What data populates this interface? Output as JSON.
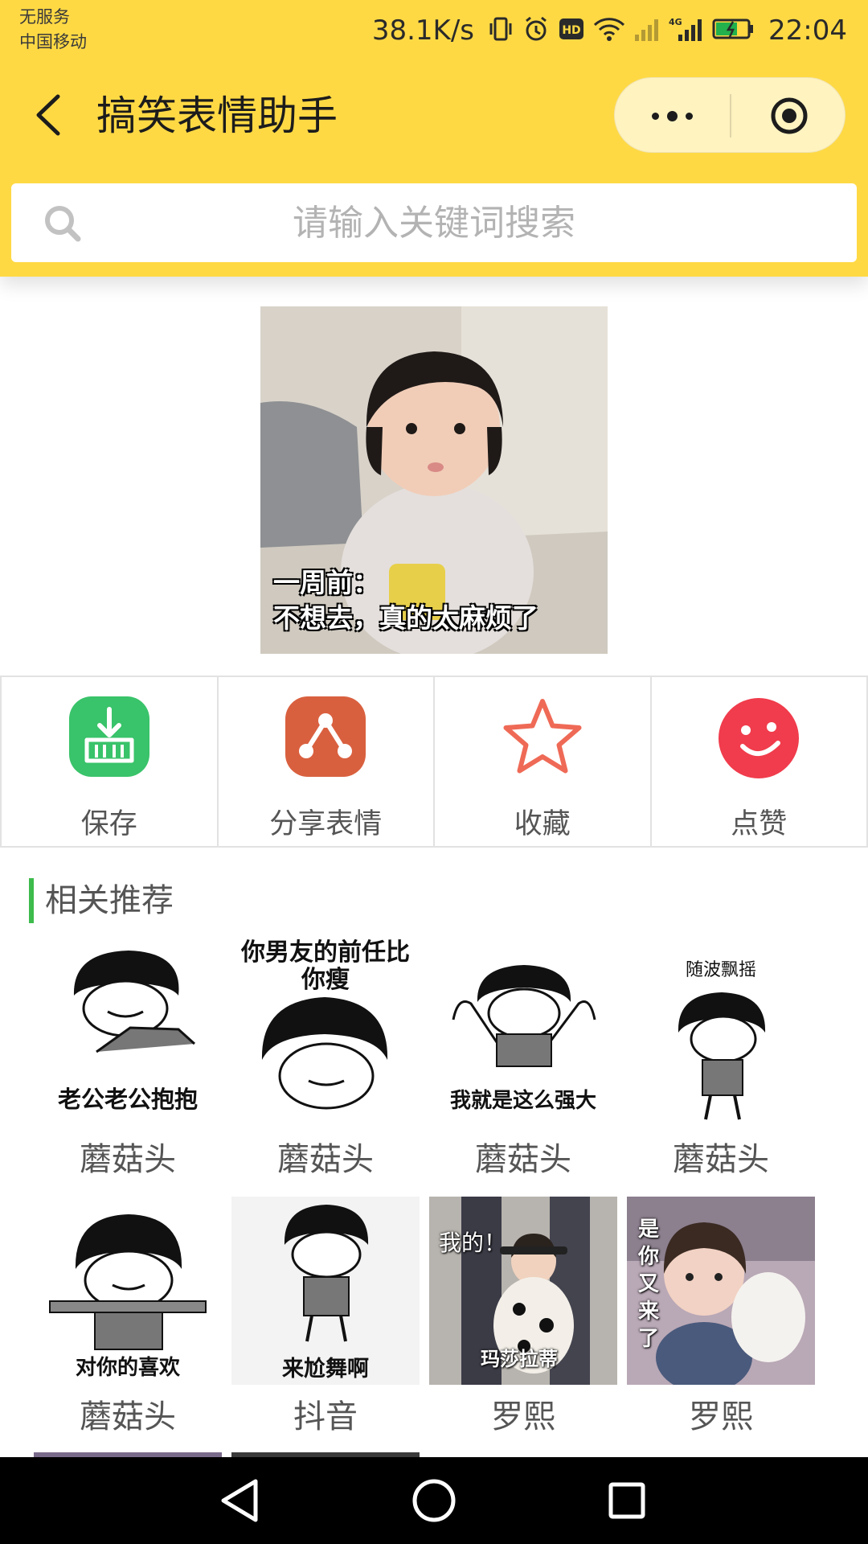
{
  "status_bar": {
    "carrier_line1": "无服务",
    "carrier_line2": "中国移动",
    "net_speed": "38.1K/s",
    "hd_badge": "HD",
    "signal_tag": "4G",
    "time": "22:04"
  },
  "header": {
    "title": "搞笑表情助手"
  },
  "search": {
    "placeholder": "请输入关键词搜索"
  },
  "main_meme": {
    "caption_line1": "一周前：",
    "caption_line2": "不想去，真的太麻烦了"
  },
  "actions": [
    {
      "label": "保存",
      "icon": "save-download-icon",
      "color": "#39c36a"
    },
    {
      "label": "分享表情",
      "icon": "share-icon",
      "color": "#d9603f"
    },
    {
      "label": "收藏",
      "icon": "star-icon",
      "color": "#ef6a56"
    },
    {
      "label": "点赞",
      "icon": "smile-like-icon",
      "color": "#f03c4c"
    }
  ],
  "recommend": {
    "title": "相关推荐",
    "accent_color": "#3dbb4c",
    "items": [
      {
        "name": "蘑菇头",
        "meme_text": "老公老公抱抱"
      },
      {
        "name": "蘑菇头",
        "meme_text": "你男友的前任比你瘦"
      },
      {
        "name": "蘑菇头",
        "meme_text": "我就是这么强大"
      },
      {
        "name": "蘑菇头",
        "meme_text": "随波飘摇"
      },
      {
        "name": "蘑菇头",
        "meme_text": "对你的喜欢"
      },
      {
        "name": "抖音",
        "meme_text": "来尬舞啊"
      },
      {
        "name": "罗熙",
        "meme_text": "我的！",
        "meme_text2": "玛莎拉蒂"
      },
      {
        "name": "罗熙",
        "meme_text": "是你又来了"
      }
    ]
  },
  "colors": {
    "header_yellow": "#ffd944",
    "capsule_bg": "#fff3c0"
  }
}
